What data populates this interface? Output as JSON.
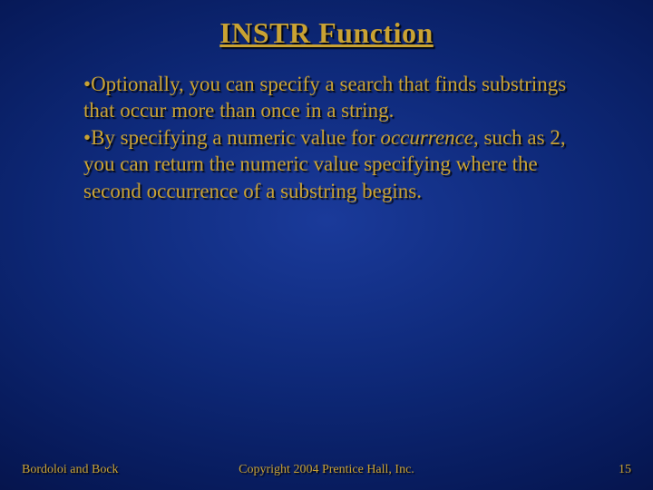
{
  "title": "INSTR Function",
  "bullets": [
    {
      "bullet_char": "•",
      "text_before": "Optionally, you can specify a search that finds substrings that occur more than once in a string.",
      "italic_word": "",
      "text_after": ""
    },
    {
      "bullet_char": "•",
      "text_before": "By specifying a numeric value for ",
      "italic_word": "occurrence",
      "text_after": ", such as 2, you can return the numeric value specifying where the second occurrence of a substring begins."
    }
  ],
  "footer": {
    "left": "Bordoloi and Bock",
    "center": "Copyright 2004 Prentice Hall, Inc.",
    "right": "15"
  }
}
